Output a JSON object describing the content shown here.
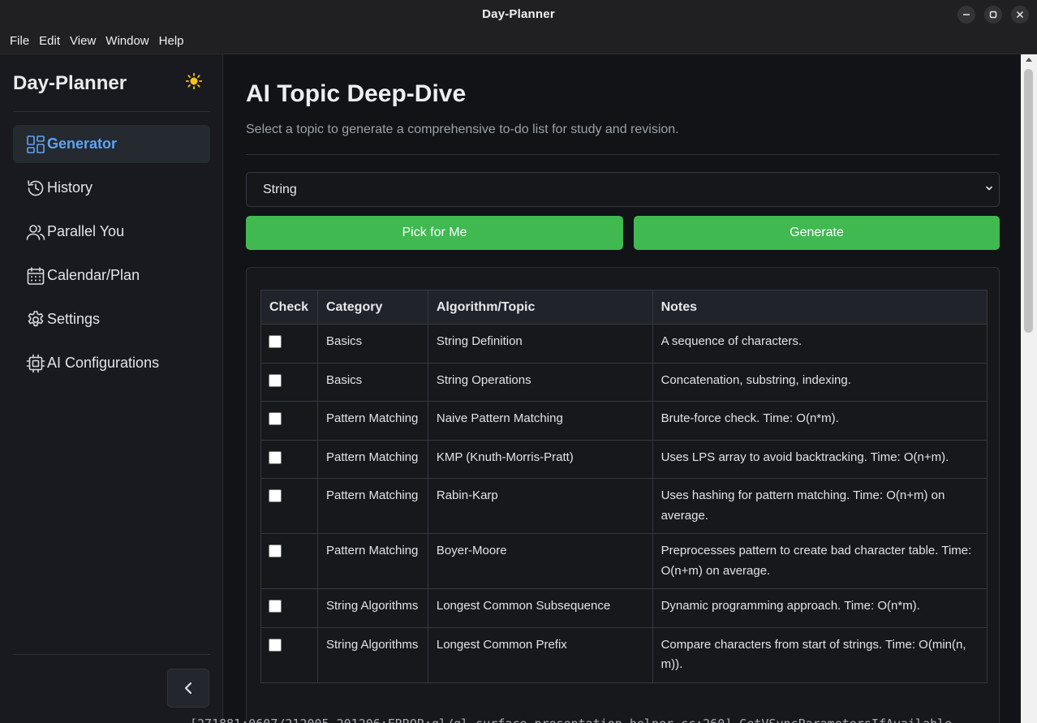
{
  "window": {
    "title": "Day-Planner",
    "controls": [
      "minimize",
      "maximize",
      "close"
    ]
  },
  "menu": [
    "File",
    "Edit",
    "View",
    "Window",
    "Help"
  ],
  "sidebar": {
    "brand": "Day-Planner",
    "theme_icon": "sun-icon",
    "items": [
      {
        "label": "Generator",
        "icon": "dashboard-icon",
        "active": true
      },
      {
        "label": "History",
        "icon": "history-icon",
        "active": false
      },
      {
        "label": "Parallel You",
        "icon": "users-icon",
        "active": false
      },
      {
        "label": "Calendar/Plan",
        "icon": "calendar-icon",
        "active": false
      },
      {
        "label": "Settings",
        "icon": "gear-icon",
        "active": false
      },
      {
        "label": "AI Configurations",
        "icon": "cpu-icon",
        "active": false
      }
    ],
    "collapse_icon": "chevron-left-icon"
  },
  "main": {
    "title": "AI Topic Deep-Dive",
    "subtitle": "Select a topic to generate a comprehensive to-do list for study and revision.",
    "topic_select": {
      "value": "String"
    },
    "pick_button": "Pick for Me",
    "generate_button": "Generate",
    "table": {
      "headers": [
        "Check",
        "Category",
        "Algorithm/Topic",
        "Notes"
      ],
      "rows": [
        {
          "category": "Basics",
          "topic": "String Definition",
          "notes": "A sequence of characters."
        },
        {
          "category": "Basics",
          "topic": "String Operations",
          "notes": "Concatenation, substring, indexing."
        },
        {
          "category": "Pattern Matching",
          "topic": "Naive Pattern Matching",
          "notes": "Brute-force check. Time: O(n*m)."
        },
        {
          "category": "Pattern Matching",
          "topic": "KMP (Knuth-Morris-Pratt)",
          "notes": "Uses LPS array to avoid backtracking. Time: O(n+m)."
        },
        {
          "category": "Pattern Matching",
          "topic": "Rabin-Karp",
          "notes": "Uses hashing for pattern matching. Time: O(n+m) on average."
        },
        {
          "category": "Pattern Matching",
          "topic": "Boyer-Moore",
          "notes": "Preprocesses pattern to create bad character table. Time: O(n+m) on average."
        },
        {
          "category": "String Algorithms",
          "topic": "Longest Common Subsequence",
          "notes": "Dynamic programming approach. Time: O(n*m)."
        },
        {
          "category": "String Algorithms",
          "topic": "Longest Common Prefix",
          "notes": "Compare characters from start of strings. Time: O(min(n, m))."
        }
      ]
    }
  },
  "terminal_line": "[271881:0607/212005.201206:ERROR:gl/gl_surface_presentation_helper.cc:260] GetVSyncParametersIfAvailable"
}
